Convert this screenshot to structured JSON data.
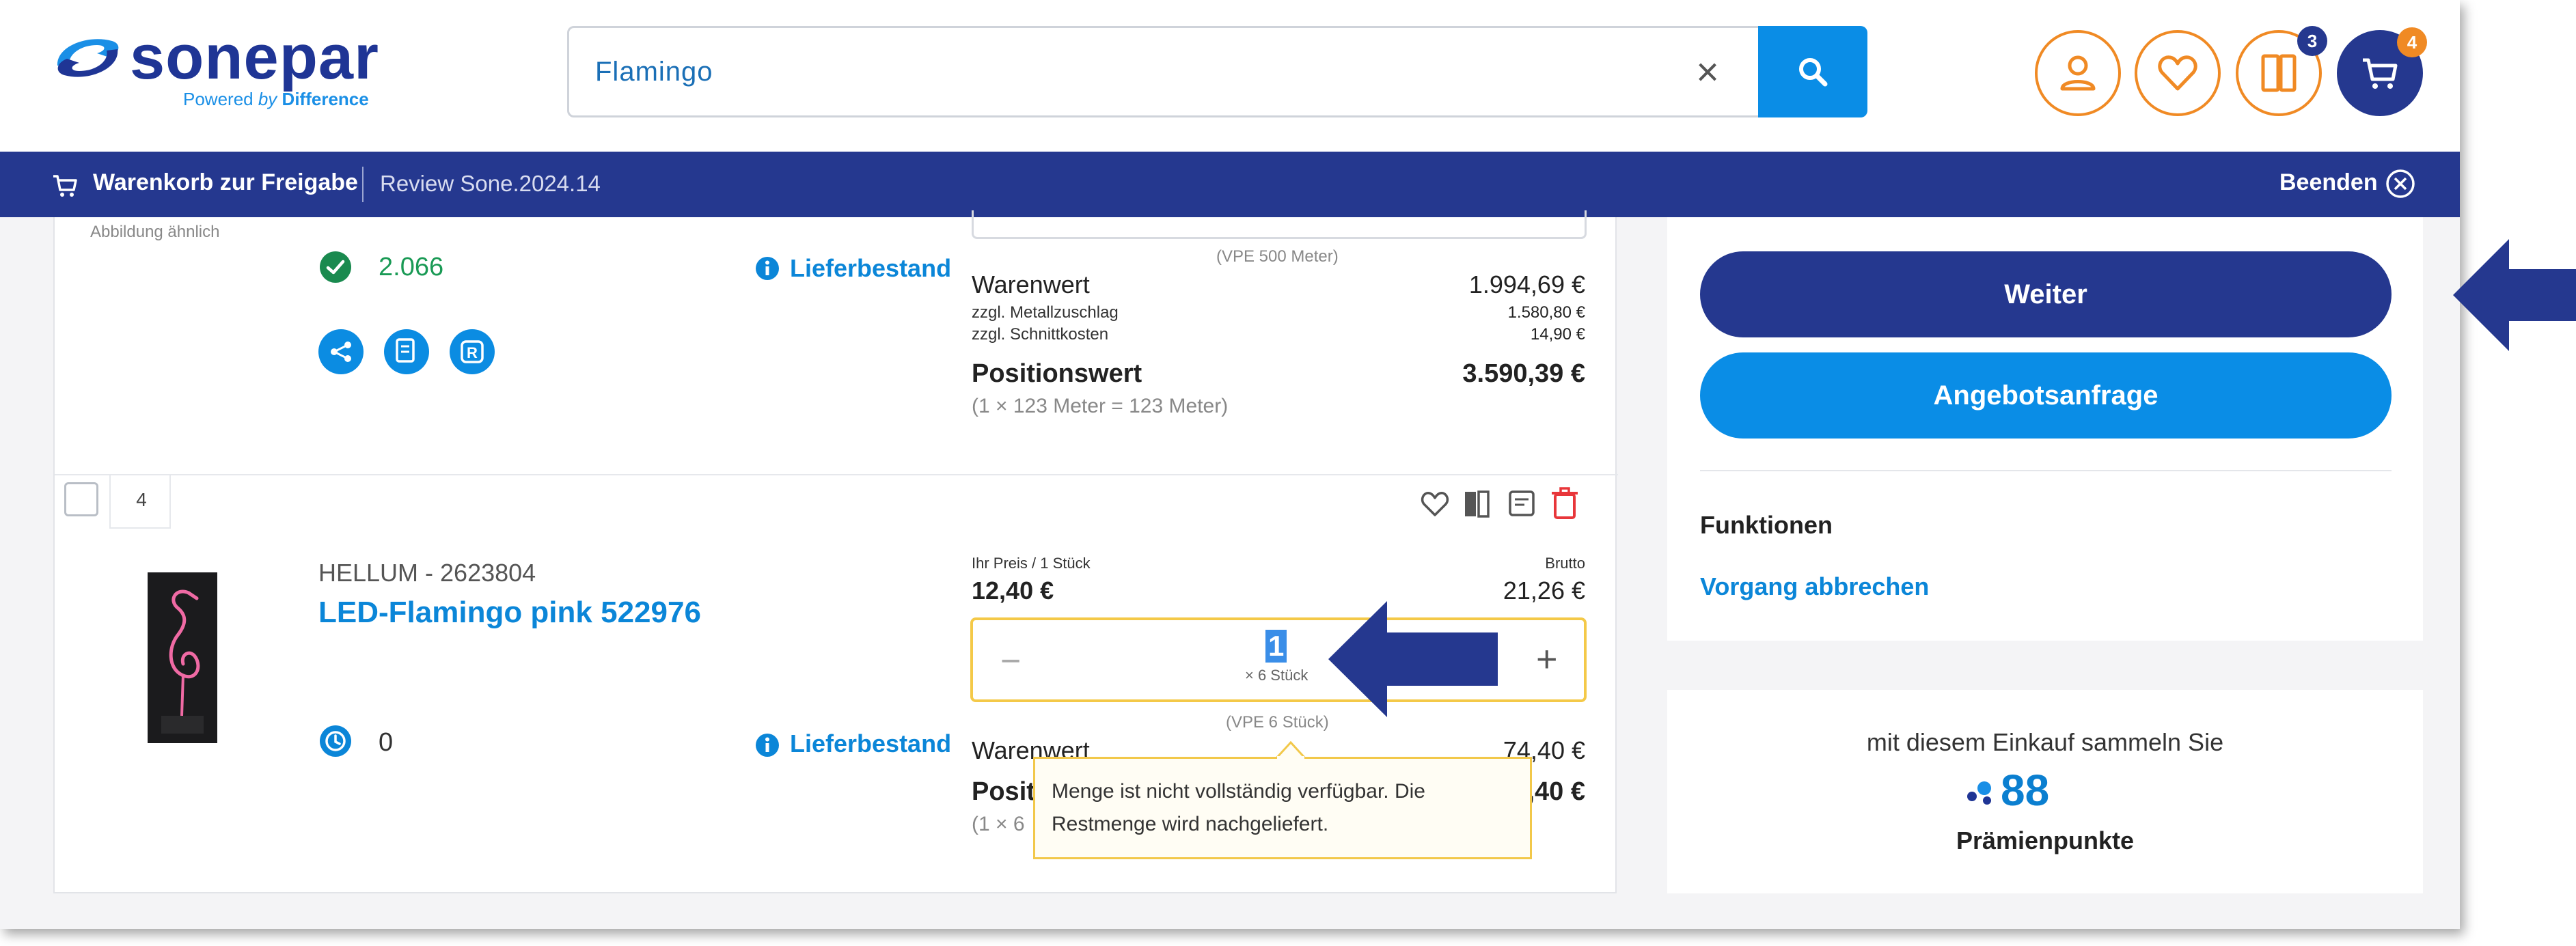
{
  "header": {
    "logo_word": "sonepar",
    "logo_tag_prefix": "Powered ",
    "logo_tag_by": "by",
    "logo_tag_suffix": "Difference",
    "search_value": "Flamingo",
    "compare_badge": "3",
    "cart_badge": "4"
  },
  "bar": {
    "title": "Warenkorb zur Freigabe",
    "review": "Review Sone.2024.14",
    "end": "Beenden"
  },
  "item3": {
    "image_note": "Abbildung ähnlich",
    "stock": "2.066",
    "stock_label": "Lieferbestand",
    "vpe": "(VPE 500 Meter)",
    "warenwert_label": "Warenwert",
    "warenwert": "1.994,69 €",
    "metal_label": "zzgl. Metallzuschlag",
    "metal": "1.580,80 €",
    "cut_label": "zzgl. Schnittkosten",
    "cut": "14,90 €",
    "pos_label": "Positionswert",
    "pos_value": "3.590,39 €",
    "pos_calc": "(1 × 123 Meter = 123 Meter)"
  },
  "item4": {
    "number": "4",
    "brand": "HELLUM - 2623804",
    "name": "LED-Flamingo pink 522976",
    "price_label": "Ihr Preis / 1 Stück",
    "price": "12,40 €",
    "brutto_label": "Brutto",
    "brutto": "21,26 €",
    "qty": "1",
    "qty_unit": "× 6 Stück",
    "vpe": "(VPE 6 Stück)",
    "stock": "0",
    "stock_label": "Lieferbestand",
    "warenwert_label": "Warenwert",
    "warenwert": "74,40 €",
    "pos_label": "Posit",
    "pos_value": ",40 €",
    "pos_calc": "(1 × 6",
    "tooltip": "Menge ist nicht vollständig verfügbar. Die Restmenge wird nachgeliefert."
  },
  "sidebar": {
    "weiter": "Weiter",
    "angebot": "Angebotsanfrage",
    "functions": "Funktionen",
    "cancel": "Vorgang abbrechen",
    "points_text": "mit diesem Einkauf sammeln Sie",
    "points": "88",
    "points_label": "Prämienpunkte"
  },
  "colors": {
    "brand_dark": "#25388f",
    "brand_blue": "#0a8de6",
    "accent_orange": "#f08a24",
    "warning_yellow": "#f4c948"
  },
  "icons": [
    "user-icon",
    "heart-icon",
    "compare-icon",
    "cart-icon",
    "search-icon",
    "close-icon",
    "trash-icon",
    "note-icon"
  ]
}
